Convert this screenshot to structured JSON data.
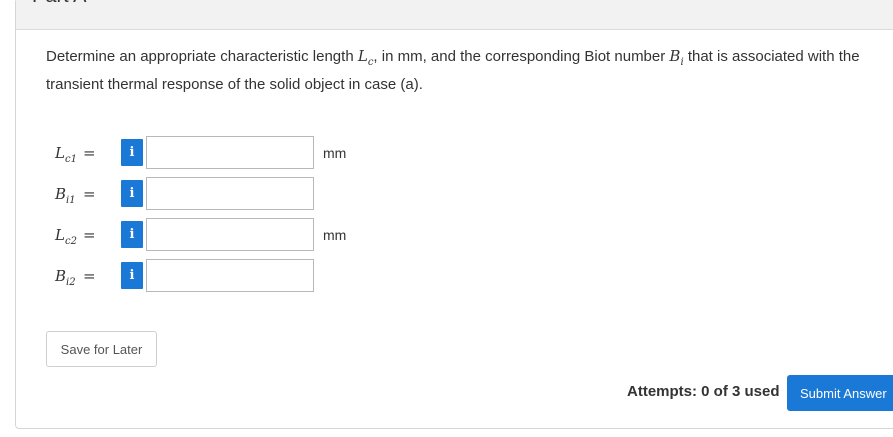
{
  "part": {
    "title": "Part A"
  },
  "question": {
    "pre": "Determine an appropriate characteristic length ",
    "lc_sym": "L",
    "lc_sub": "c",
    "mid": ", in mm, and the corresponding Biot number ",
    "bi_sym": "B",
    "bi_sub": "i",
    "post": " that is associated with the",
    "line2": "transient thermal response of the solid object in case (a)."
  },
  "inputs": [
    {
      "sym": "L",
      "sub": "c1",
      "eq": "=",
      "info": "i",
      "value": "",
      "unit": "mm"
    },
    {
      "sym": "B",
      "sub": "i1",
      "eq": "=",
      "info": "i",
      "value": "",
      "unit": ""
    },
    {
      "sym": "L",
      "sub": "c2",
      "eq": "=",
      "info": "i",
      "value": "",
      "unit": "mm"
    },
    {
      "sym": "B",
      "sub": "i2",
      "eq": "=",
      "info": "i",
      "value": "",
      "unit": ""
    }
  ],
  "actions": {
    "save_label": "Save for Later",
    "attempts_text": "Attempts: 0 of 3 used",
    "submit_label": "Submit Answer"
  },
  "colors": {
    "accent": "#1a78d6",
    "header_bg": "#f2f2f2",
    "border": "#d6d6d6"
  }
}
